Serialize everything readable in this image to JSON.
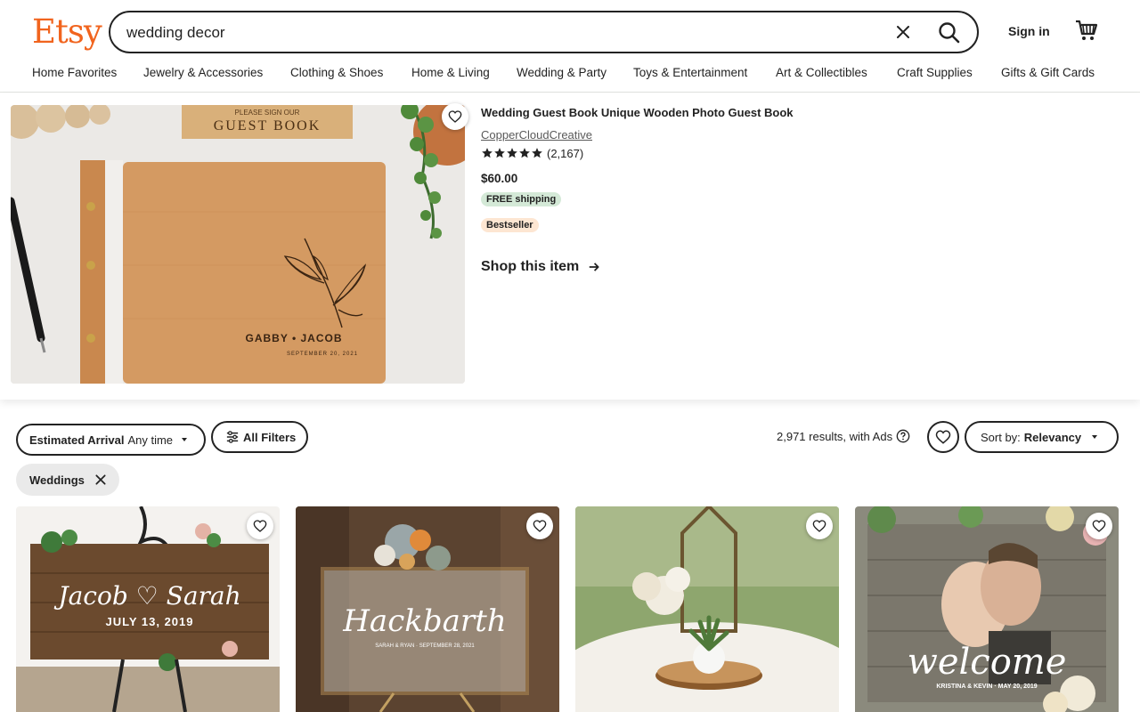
{
  "brand": {
    "logo_text": "Etsy",
    "accent": "#f1641e"
  },
  "search": {
    "value": "wedding decor",
    "clear_icon": "close-icon",
    "submit_icon": "search-icon"
  },
  "header": {
    "signin_label": "Sign in",
    "cart_icon": "cart-icon"
  },
  "nav": [
    "Home Favorites",
    "Jewelry & Accessories",
    "Clothing & Shoes",
    "Home & Living",
    "Wedding & Party",
    "Toys & Entertainment",
    "Art & Collectibles",
    "Craft Supplies",
    "Gifts & Gift Cards"
  ],
  "featured": {
    "title": "Wedding Guest Book Unique Wooden Photo Guest Book",
    "shop": "CopperCloudCreative",
    "rating": 5,
    "reviews": "(2,167)",
    "price": "$60.00",
    "shipping_badge": "FREE shipping",
    "bestseller_badge": "Bestseller",
    "cta": "Shop this item",
    "image": {
      "sign_line1": "PLEASE SIGN OUR",
      "sign_line2": "GUEST BOOK",
      "names": "GABBY • JACOB",
      "date": "SEPTEMBER 20, 2021"
    },
    "colors": {
      "free_shipping_bg": "#d4e9d7",
      "bestseller_bg": "#fde6d2"
    }
  },
  "filters": {
    "arrival_label": "Estimated Arrival",
    "arrival_value": "Any time",
    "all_filters_label": "All Filters",
    "results_text": "2,971 results, with Ads",
    "sort_label": "Sort by:",
    "sort_value": "Relevancy",
    "active_chip": "Weddings"
  },
  "products": [
    {
      "image_text_1": "Jacob ♡ Sarah",
      "image_text_2": "JULY 13, 2019"
    },
    {
      "image_text_1": "Hackbarth",
      "image_text_2": "SARAH & RYAN · SEPTEMBER 28, 2021"
    },
    {
      "image_text_1": "",
      "image_text_2": ""
    },
    {
      "image_text_1": "welcome",
      "image_text_2": "KRISTINA & KEVIN · MAY 20, 2019"
    }
  ]
}
